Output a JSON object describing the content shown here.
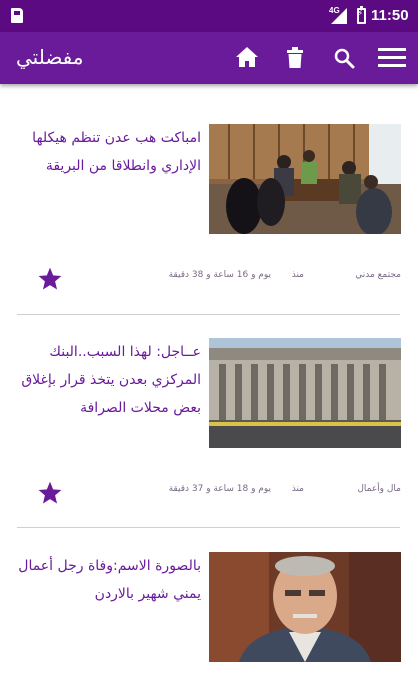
{
  "status_bar": {
    "network": "4G",
    "time": "11:50"
  },
  "app_bar": {
    "title": "مفضلتي"
  },
  "articles": [
    {
      "title": "امباكت هب عدن تنظم هيكلها الإداري وانطلاقا من البريقة",
      "category": "مجتمع مدني",
      "since": "منذ",
      "elapsed": "يوم و 16 ساعة و 38 دقيقة",
      "image": "meeting-photo"
    },
    {
      "title": "عــاجل: لهذا السبب..البنك المركزي بعدن يتخذ قرار بإغلاق بعض محلات الصرافة",
      "category": "مال وأعمال",
      "since": "منذ",
      "elapsed": "يوم و 18 ساعة و 37 دقيقة",
      "image": "bank-building-photo"
    },
    {
      "title": "بالصورة الاسم:وفاة رجل أعمال يمني شهير بالاردن",
      "image": "portrait-photo"
    }
  ],
  "colors": {
    "status_bar": "#5c0a82",
    "app_bar": "#6a1b9a",
    "accent": "#6a1b9a",
    "meta_text": "#7a6a86",
    "divider": "#cfcfcf"
  }
}
